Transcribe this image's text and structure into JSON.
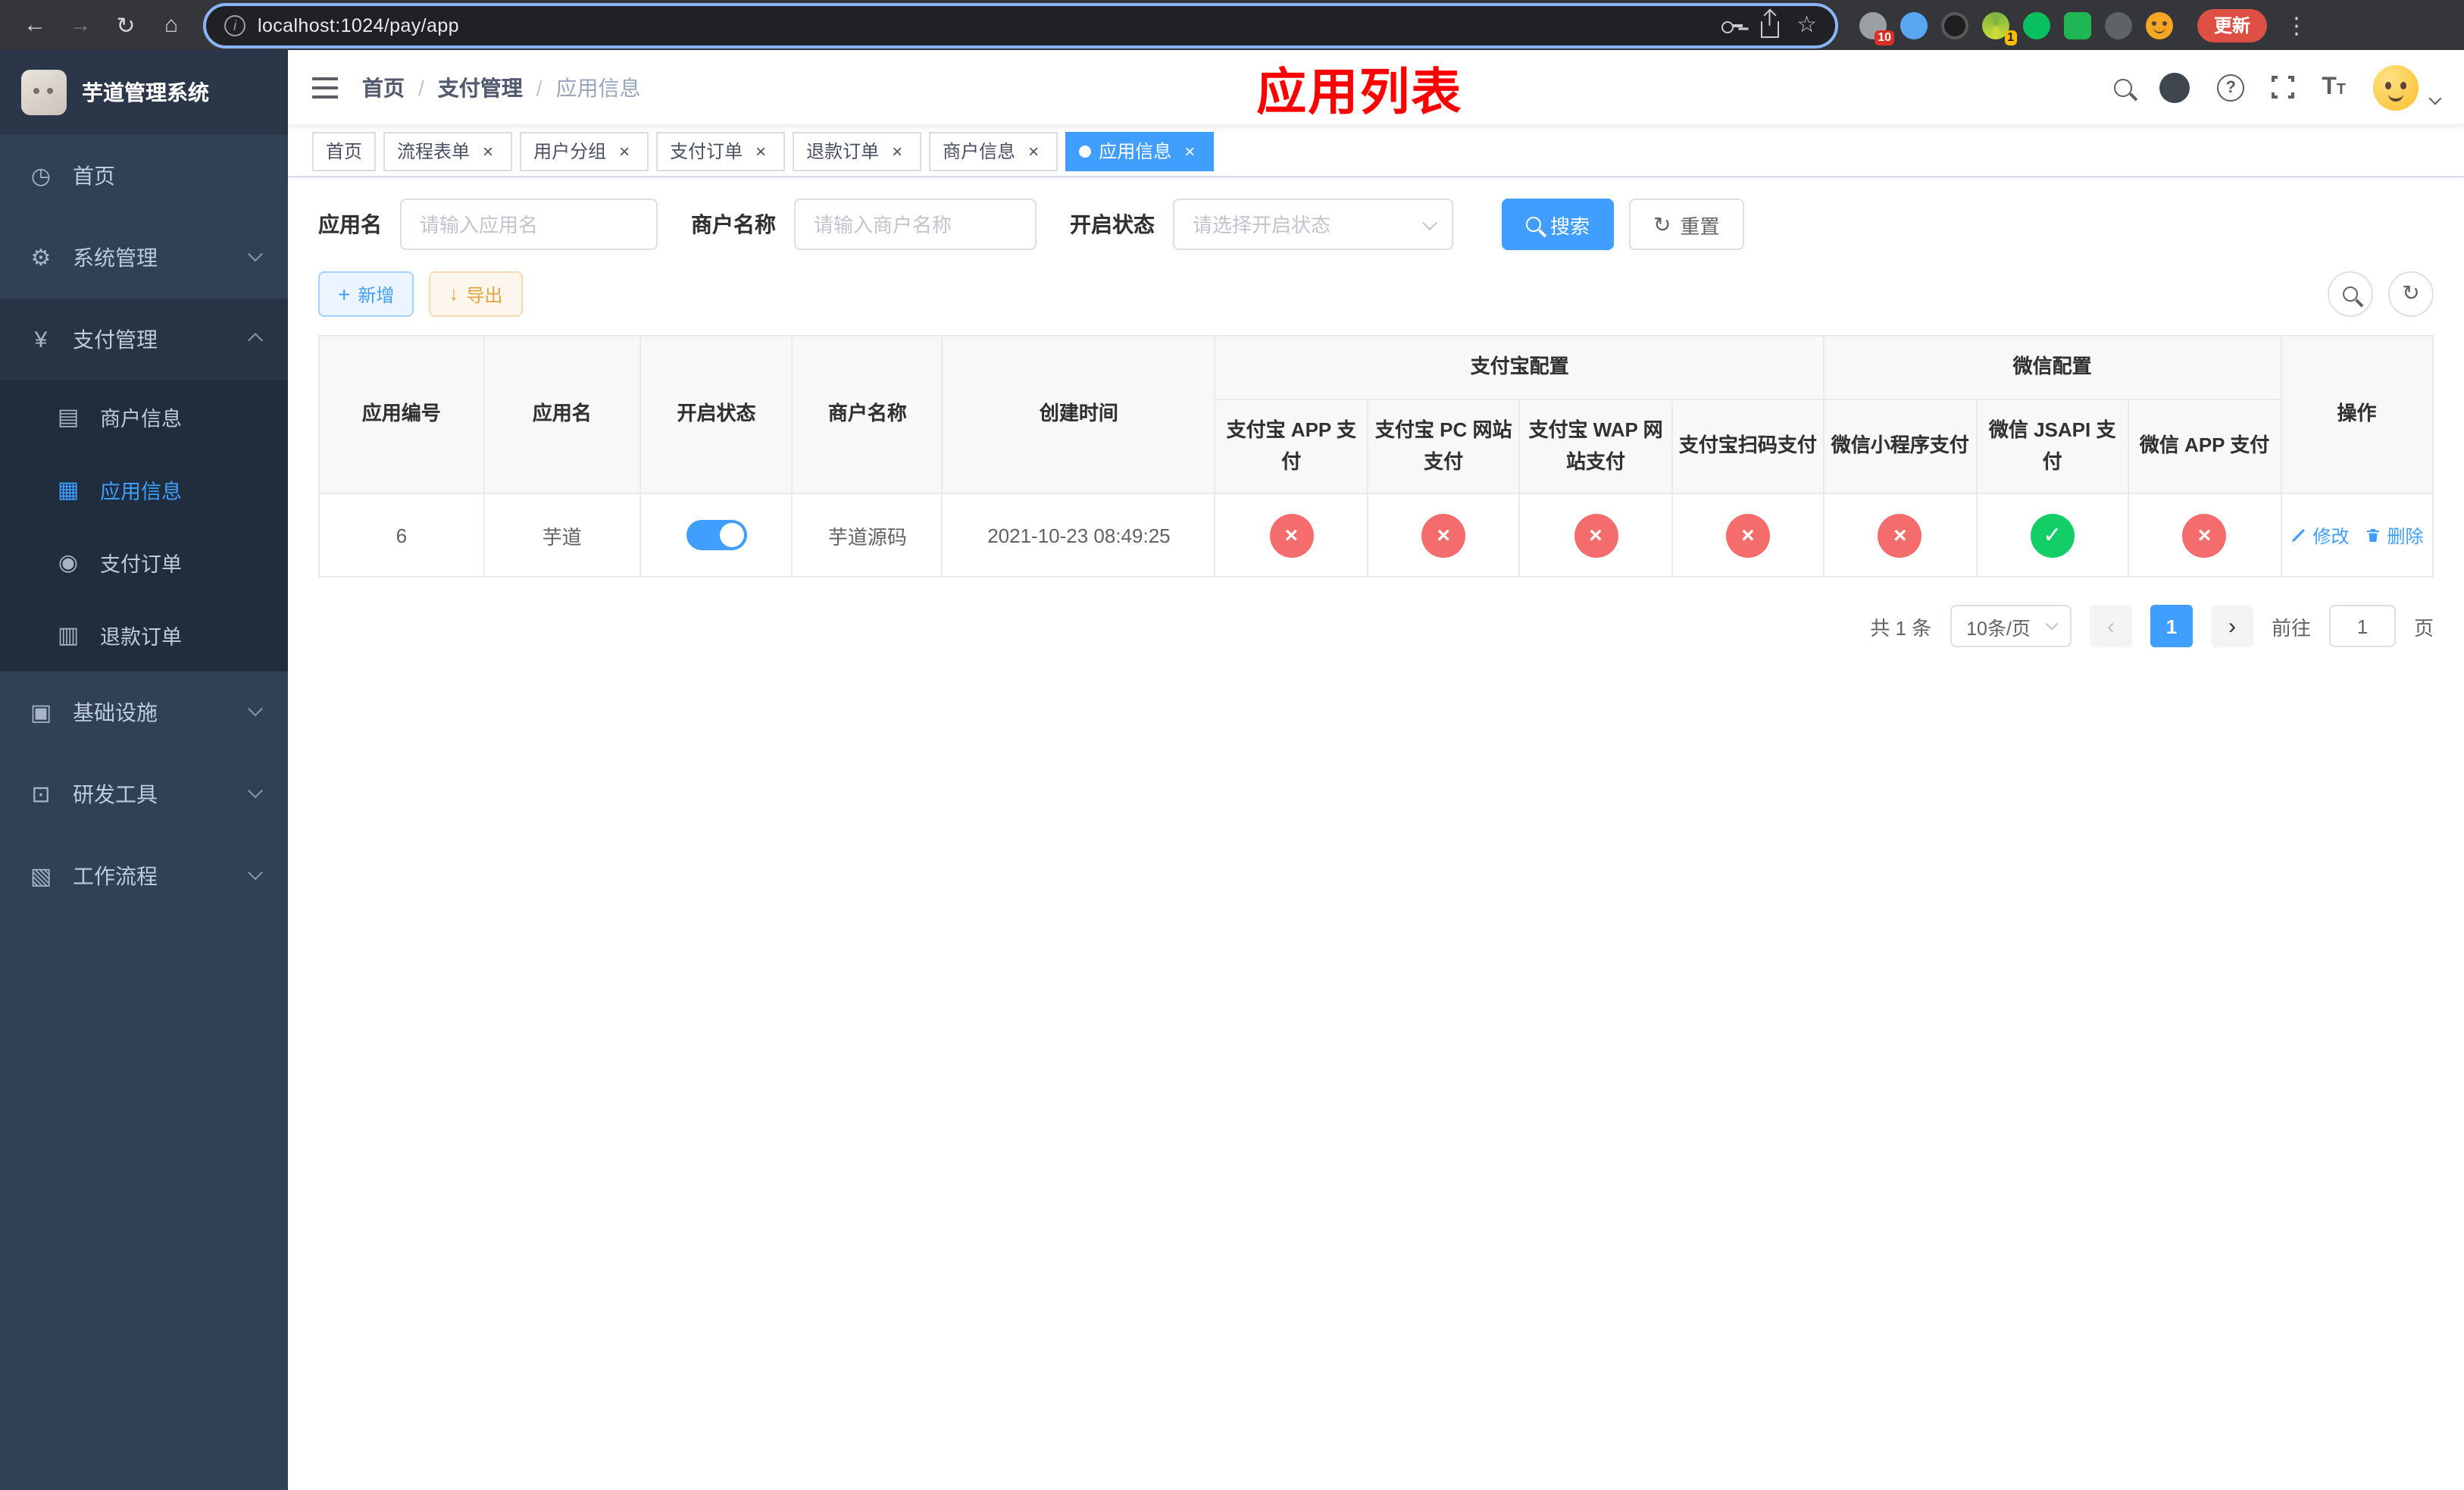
{
  "browser": {
    "nav": {
      "back": "←",
      "forward": "→",
      "reload": "↻",
      "home": "⌂"
    },
    "url": "localhost:1024/pay/app",
    "update_label": "更新",
    "ext_badges": {
      "puzzle": "10",
      "profile": "1"
    }
  },
  "sidebar": {
    "title": "芋道管理系统",
    "items": [
      {
        "label": "首页",
        "icon": "◷"
      },
      {
        "label": "系统管理",
        "icon": "⚙"
      },
      {
        "label": "支付管理",
        "icon": "¥"
      },
      {
        "label": "基础设施",
        "icon": "▣"
      },
      {
        "label": "研发工具",
        "icon": "⊡"
      },
      {
        "label": "工作流程",
        "icon": "▧"
      }
    ],
    "payment_children": [
      {
        "label": "商户信息",
        "icon": "▤"
      },
      {
        "label": "应用信息",
        "icon": "▦"
      },
      {
        "label": "支付订单",
        "icon": "◉"
      },
      {
        "label": "退款订单",
        "icon": "▥"
      }
    ]
  },
  "header": {
    "breadcrumb": [
      "首页",
      "支付管理",
      "应用信息"
    ],
    "banner": "应用列表"
  },
  "tabs": [
    {
      "label": "首页",
      "closable": false,
      "active": false
    },
    {
      "label": "流程表单",
      "closable": true,
      "active": false
    },
    {
      "label": "用户分组",
      "closable": true,
      "active": false
    },
    {
      "label": "支付订单",
      "closable": true,
      "active": false
    },
    {
      "label": "退款订单",
      "closable": true,
      "active": false
    },
    {
      "label": "商户信息",
      "closable": true,
      "active": false
    },
    {
      "label": "应用信息",
      "closable": true,
      "active": true
    }
  ],
  "filters": {
    "app_name_label": "应用名",
    "app_name_placeholder": "请输入应用名",
    "merchant_label": "商户名称",
    "merchant_placeholder": "请输入商户名称",
    "status_label": "开启状态",
    "status_placeholder": "请选择开启状态",
    "search_label": "搜索",
    "reset_label": "重置"
  },
  "toolbar": {
    "add_label": "新增",
    "export_label": "导出"
  },
  "table": {
    "group_alipay": "支付宝配置",
    "group_wechat": "微信配置",
    "columns": {
      "id": "应用编号",
      "name": "应用名",
      "status": "开启状态",
      "merchant": "商户名称",
      "created": "创建时间",
      "alipay_app": "支付宝 APP 支付",
      "alipay_pc": "支付宝 PC 网站支付",
      "alipay_wap": "支付宝 WAP 网站支付",
      "alipay_qr": "支付宝扫码支付",
      "wx_mini": "微信小程序支付",
      "wx_jsapi": "微信 JSAPI 支付",
      "wx_app": "微信 APP 支付",
      "actions": "操作"
    },
    "status_glyphs": {
      "yes": "✓",
      "no": "×"
    },
    "rows": [
      {
        "id": "6",
        "name": "芋道",
        "enabled": true,
        "merchant": "芋道源码",
        "created": "2021-10-23 08:49:25",
        "alipay_app": false,
        "alipay_pc": false,
        "alipay_wap": false,
        "alipay_qr": false,
        "wx_mini": false,
        "wx_jsapi": true,
        "wx_app": false,
        "edit_label": "修改",
        "delete_label": "删除"
      }
    ]
  },
  "pagination": {
    "total": "共 1 条",
    "page_size": "10条/页",
    "current_page": "1",
    "goto_label": "前往",
    "goto_value": "1",
    "page_unit": "页"
  },
  "colors": {
    "accent": "#409eff",
    "success": "#13ce66",
    "danger": "#f56c6c",
    "sidebar": "#304156"
  }
}
